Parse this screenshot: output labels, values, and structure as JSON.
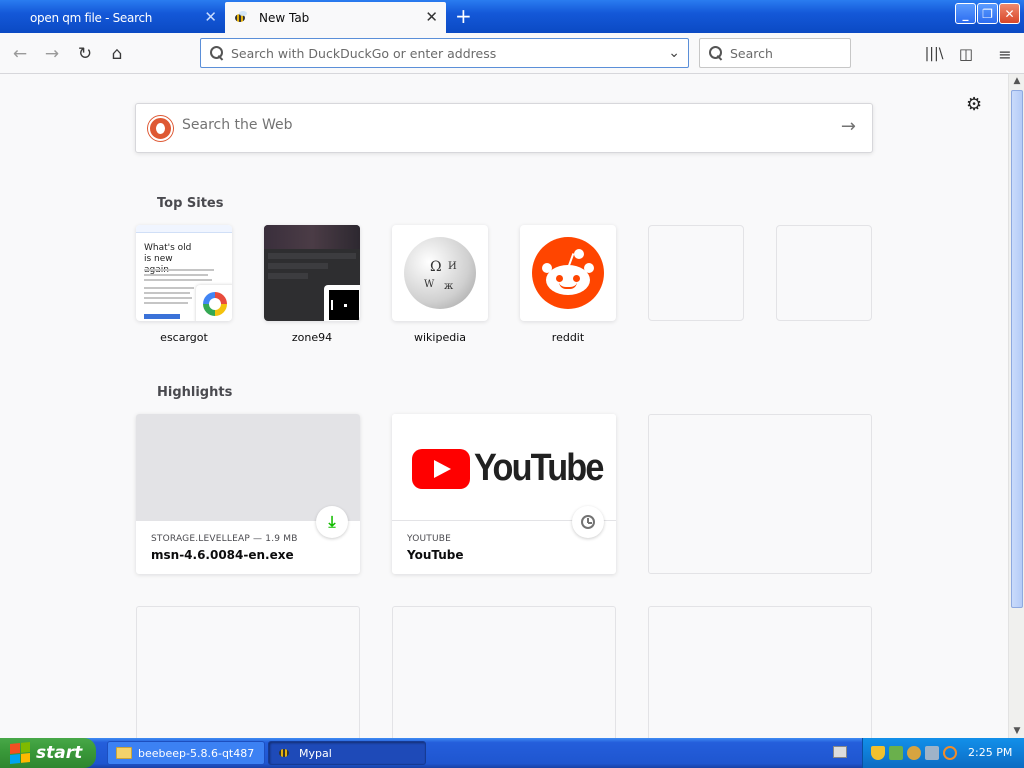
{
  "browser": {
    "tabs": [
      {
        "label": "open qm file - Search",
        "active": false
      },
      {
        "label": "New Tab",
        "active": true
      }
    ],
    "urlbar": {
      "placeholder": "Search with DuckDuckGo or enter address"
    },
    "searchbar": {
      "placeholder": "Search"
    },
    "icons": [
      "back-icon",
      "forward-icon",
      "reload-icon",
      "home-icon",
      "library-icon",
      "sidebar-icon",
      "menu-icon"
    ]
  },
  "newtab": {
    "web_search_placeholder": "Search the Web",
    "top_sites_title": "Top Sites",
    "top_sites": [
      {
        "label": "escargot",
        "tile_heading": "What's old is new again"
      },
      {
        "label": "zone94"
      },
      {
        "label": "wikipedia"
      },
      {
        "label": "reddit"
      }
    ],
    "highlights_title": "Highlights",
    "highlights": [
      {
        "source": "STORAGE.LEVELLEAP — 1.9 MB",
        "title": "msn-4.6.0084-en.exe",
        "badge": "download-icon"
      },
      {
        "source": "YOUTUBE",
        "title": "YouTube",
        "badge": "clock-icon",
        "logo_text": "YouTube"
      }
    ]
  },
  "taskbar": {
    "start_label": "start",
    "tasks": [
      {
        "label": "beebeep-5.8.6-qt487"
      },
      {
        "label": "Mypal"
      }
    ],
    "clock": "2:25 PM"
  },
  "colors": {
    "accent": "#0a84ff",
    "reddit": "#ff4500",
    "youtube": "#ff0000",
    "duckduckgo": "#de5833",
    "download_green": "#12bc00"
  }
}
